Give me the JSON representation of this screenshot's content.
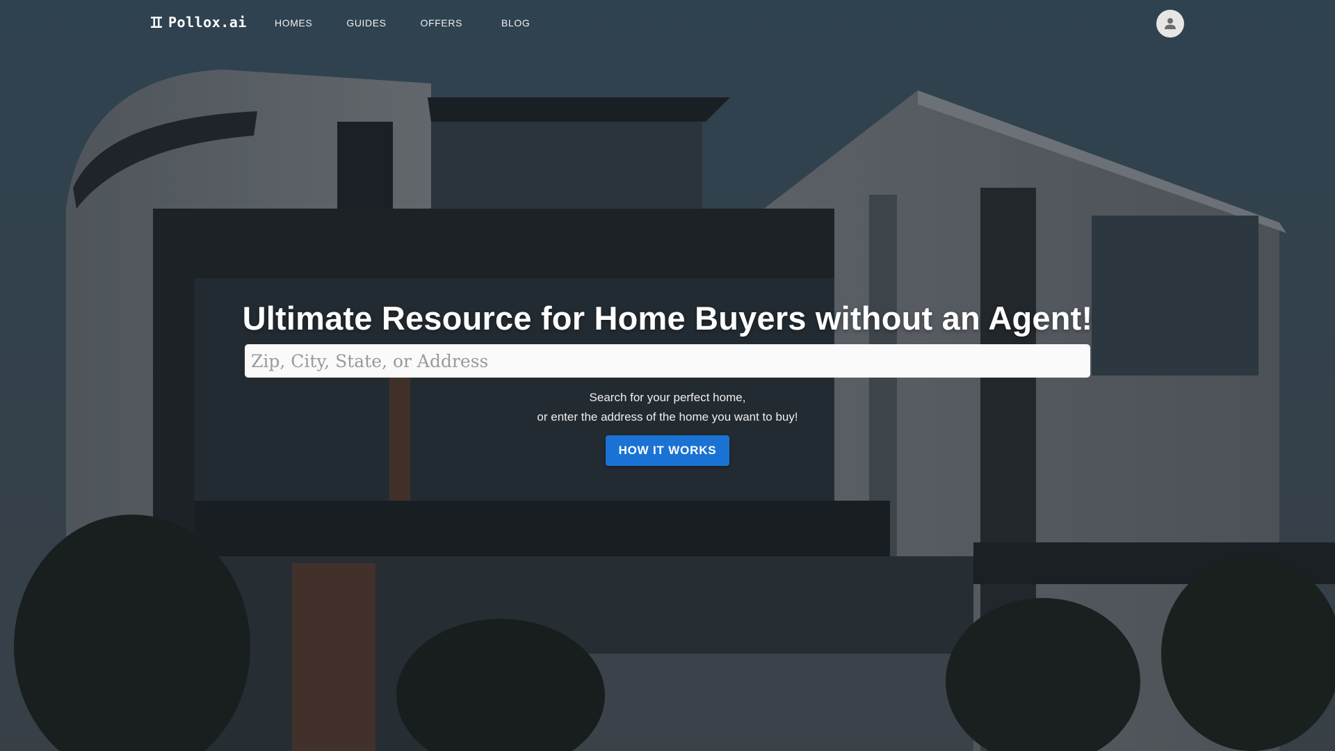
{
  "brand": {
    "name": "Pollox.ai",
    "icon": "pi-logo-icon"
  },
  "nav": {
    "items": [
      {
        "label": "HOMES"
      },
      {
        "label": "GUIDES"
      },
      {
        "label": "OFFERS"
      },
      {
        "label": "BLOG"
      }
    ],
    "account_icon": "user-avatar-icon"
  },
  "hero": {
    "headline": "Ultimate Resource for Home Buyers without an Agent!",
    "search": {
      "placeholder": "Zip, City, State, or Address",
      "value": ""
    },
    "subtext_line1": "Search for your perfect home,",
    "subtext_line2": "or enter the address of the home you want to buy!",
    "cta_label": "HOW IT WORKS"
  },
  "colors": {
    "accent": "#1a73d4",
    "input_bg": "#fafafa",
    "text": "#ffffff"
  }
}
